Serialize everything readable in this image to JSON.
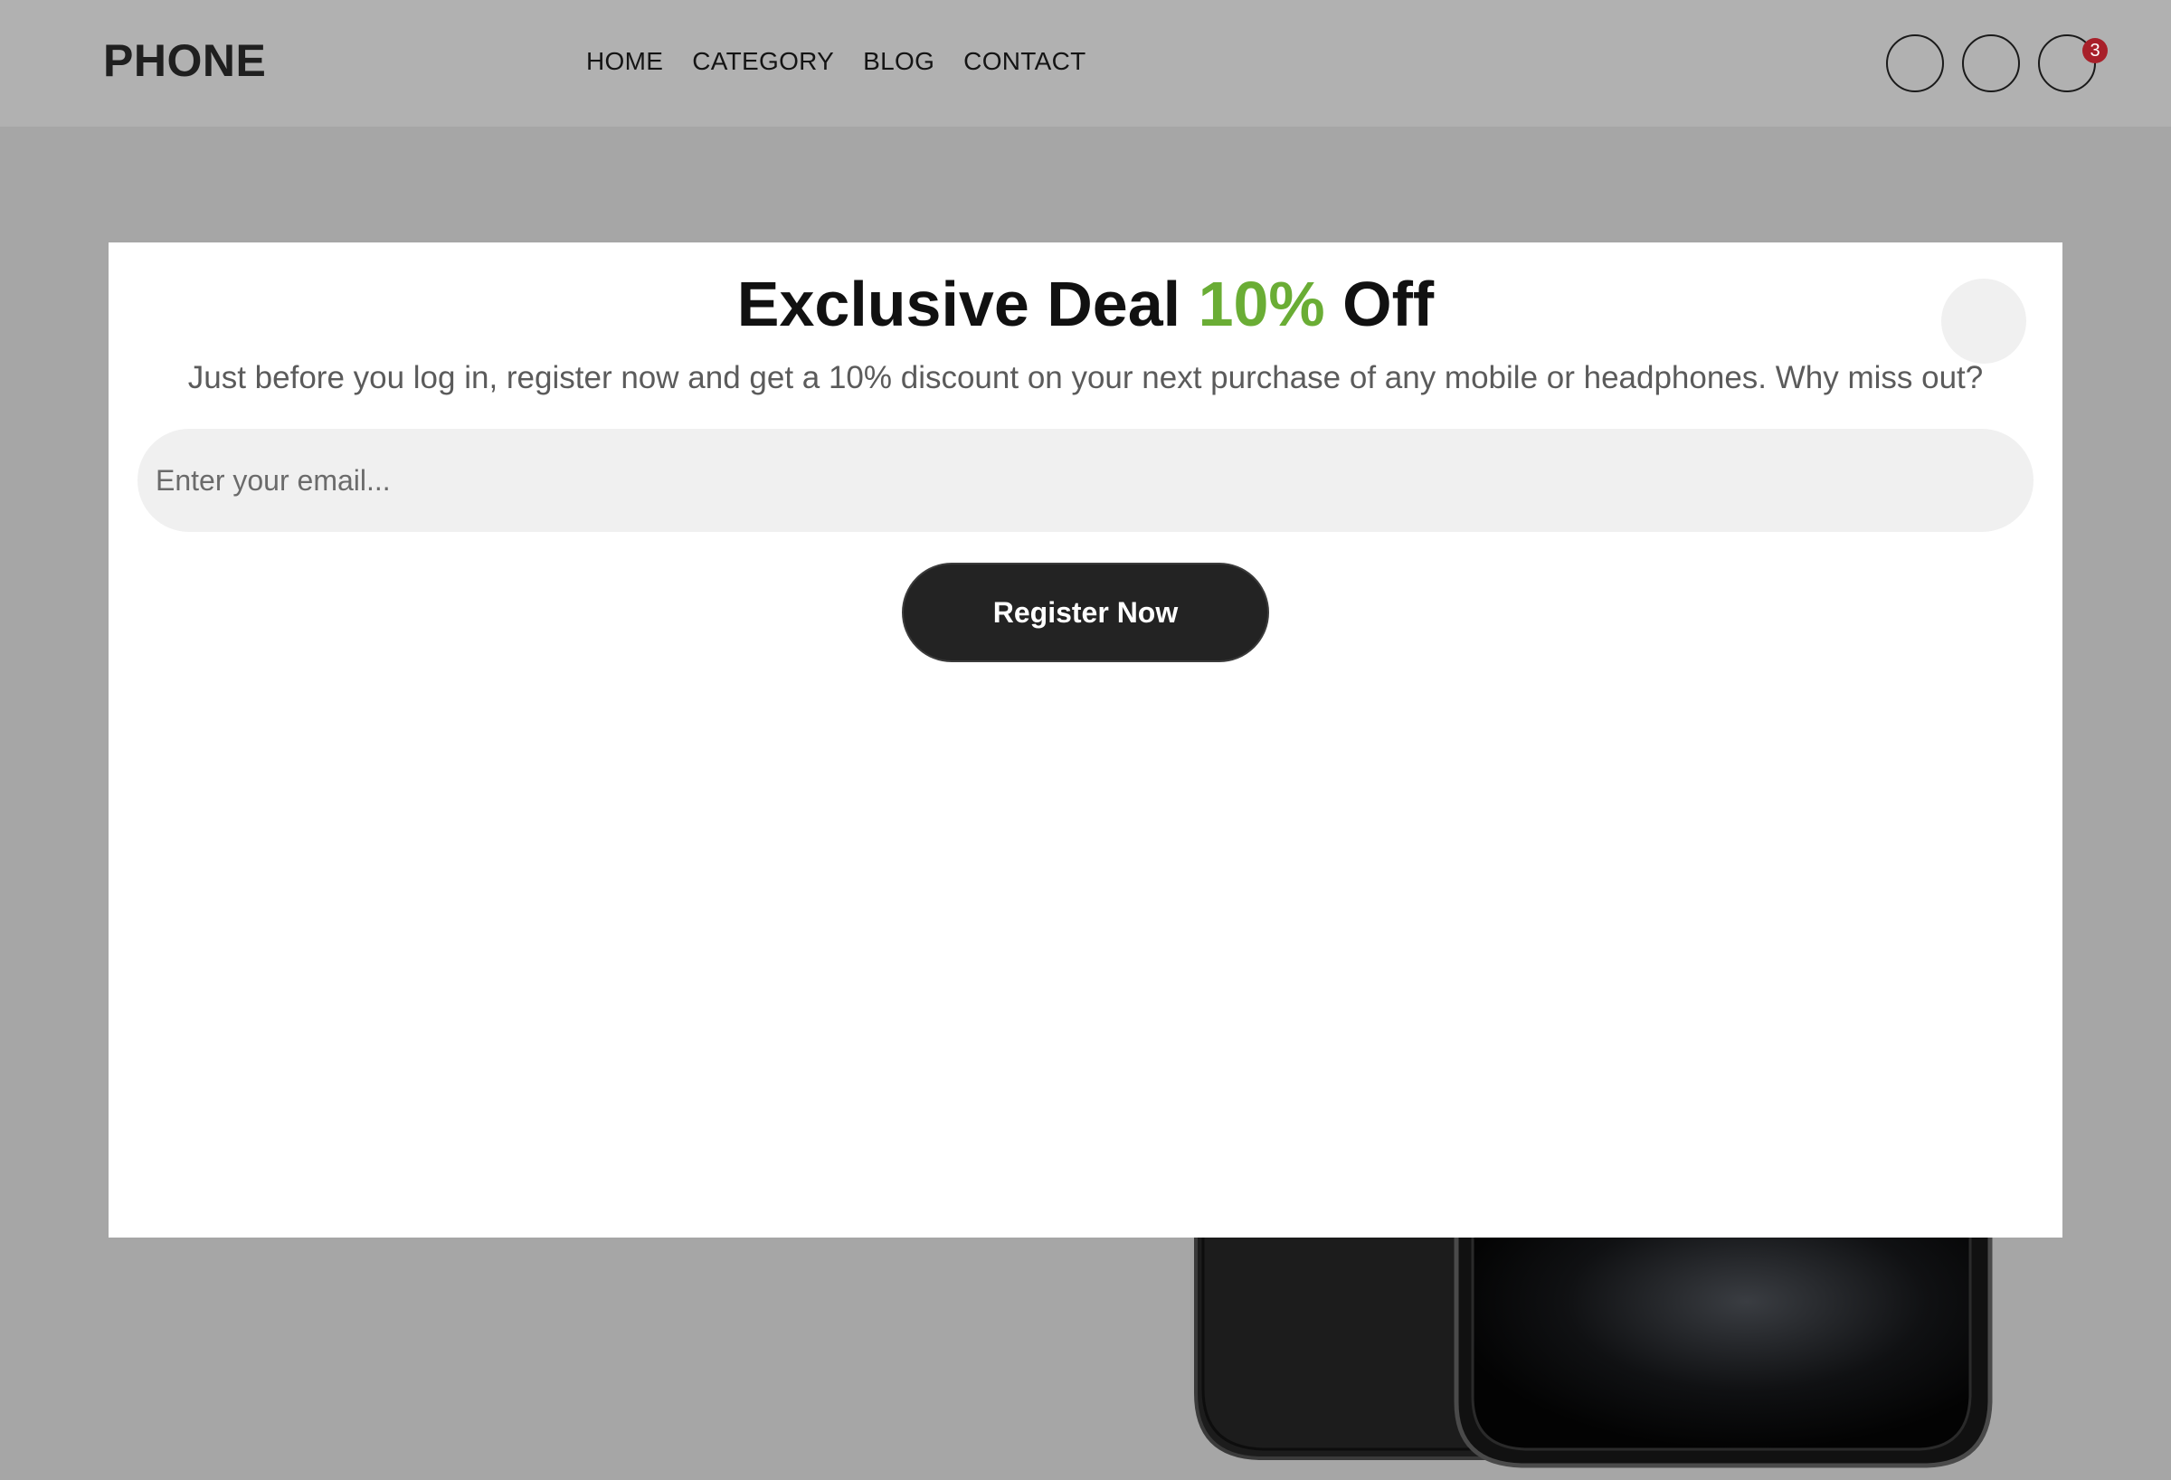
{
  "header": {
    "logo": "PHONE",
    "nav": [
      {
        "label": "HOME"
      },
      {
        "label": "CATEGORY"
      },
      {
        "label": "BLOG"
      },
      {
        "label": "CONTACT"
      }
    ],
    "icons": [
      "search-icon",
      "user-icon",
      "cart-icon"
    ],
    "cart_count": "3"
  },
  "modal": {
    "title_before": "Exclusive Deal ",
    "title_accent": "10%",
    "title_after": " Off",
    "subtitle": "Just before you log in, register now and get a 10% discount on your next purchase of any mobile or headphones. Why miss out?",
    "email_placeholder": "Enter your email...",
    "register_label": "Register Now"
  },
  "colors": {
    "accent": "#6aad35",
    "badge": "#a8202a",
    "button": "#232323",
    "overlay": "#a6a6a6"
  }
}
